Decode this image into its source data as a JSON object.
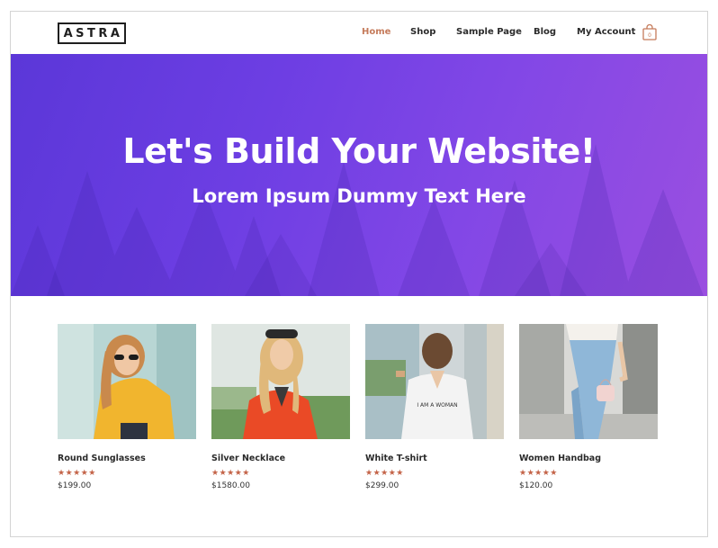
{
  "header": {
    "logo": "ASTRA",
    "nav": [
      {
        "label": "Home",
        "active": true
      },
      {
        "label": "Shop",
        "active": false
      },
      {
        "label": "Sample Page",
        "active": false
      },
      {
        "label": "Blog",
        "active": false
      },
      {
        "label": "My Account",
        "active": false
      }
    ],
    "cart_count": "0"
  },
  "hero": {
    "title": "Let's Build Your Website!",
    "subtitle": "Lorem Ipsum Dummy Text Here"
  },
  "products": [
    {
      "name": "Round Sunglasses",
      "price": "$199.00",
      "rating": 5
    },
    {
      "name": "Silver Necklace",
      "price": "$1580.00",
      "rating": 5
    },
    {
      "name": "White T-shirt",
      "price": "$299.00",
      "rating": 5
    },
    {
      "name": "Women Handbag",
      "price": "$120.00",
      "rating": 5
    }
  ],
  "colors": {
    "accent": "#c57b5b",
    "star": "#c46449",
    "hero_start": "#5b37d8",
    "hero_end": "#9a4fe0"
  },
  "icons": {
    "cart": "shopping-bag-icon",
    "rating": "star-icon"
  }
}
